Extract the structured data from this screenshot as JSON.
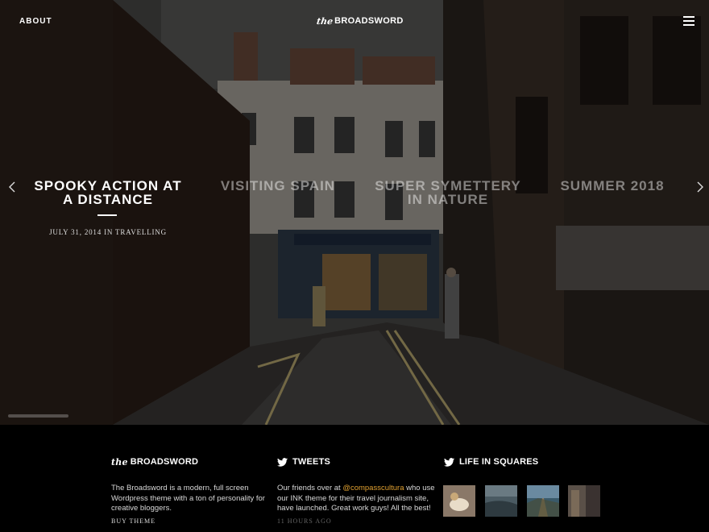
{
  "nav": {
    "about_label": "ABOUT",
    "logo_the": "the",
    "logo_name": "BROADSWORD",
    "menu_icon": "hamburger-icon"
  },
  "slider": {
    "prev_icon": "chevron-left-icon",
    "next_icon": "chevron-right-icon",
    "slides": [
      {
        "title": "SPOOKY ACTION AT A DISTANCE",
        "meta": "JULY 31, 2014 IN TRAVELLING",
        "active": true
      },
      {
        "title": "VISITING SPAIN",
        "active": false
      },
      {
        "title": "SUPER SYMETTERY IN NATURE",
        "active": false
      },
      {
        "title": "SUMMER 2018",
        "active": false
      }
    ]
  },
  "footer": {
    "about": {
      "logo_the": "the",
      "logo_name": "BROADSWORD",
      "text": "The Broadsword is a modern, full screen Wordpress theme with a ton of personality for creative bloggers.",
      "link": "BUY THEME"
    },
    "tweets": {
      "heading": "TWEETS",
      "icon": "twitter-icon",
      "text_before": "Our friends over at ",
      "mention": "@compasscultura",
      "text_after": " who use our INK theme for their travel journalism site, have launched. Great work guys! All the best!",
      "time": "11 HOURS AGO"
    },
    "squares": {
      "heading": "LIFE IN SQUARES",
      "icon": "twitter-icon"
    }
  },
  "colors": {
    "accent_mention": "#e0a030",
    "footer_bg": "#000000"
  }
}
